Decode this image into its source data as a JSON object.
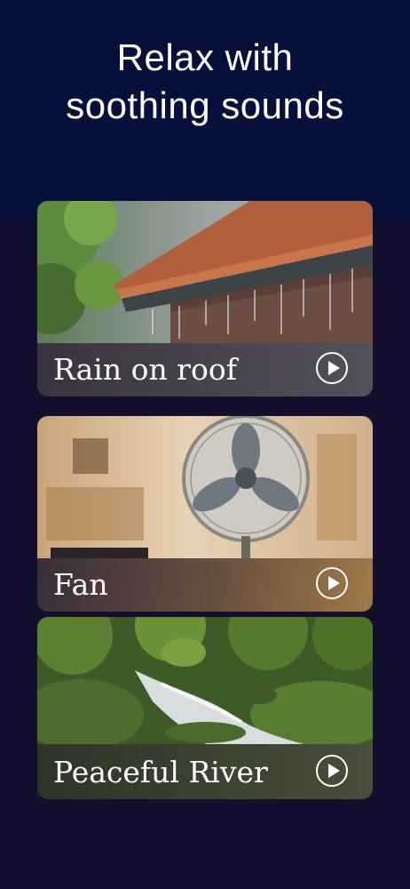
{
  "header": {
    "title_line1": "Relax with",
    "title_line2": "soothing sounds",
    "background": "#06103a"
  },
  "page_background": "#130f2e",
  "cards": [
    {
      "label": "Rain on roof",
      "image": "rain-on-roof-photo",
      "action_icon": "play-circle-icon"
    },
    {
      "label": "Fan",
      "image": "electric-fan-photo",
      "action_icon": "play-circle-icon"
    },
    {
      "label": "Peaceful River",
      "image": "forest-river-photo",
      "action_icon": "play-circle-icon"
    }
  ]
}
